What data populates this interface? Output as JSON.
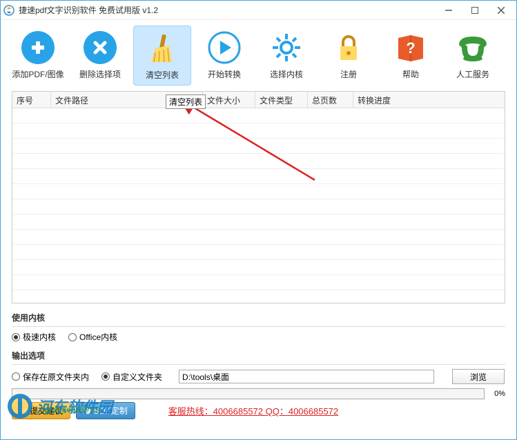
{
  "titlebar": {
    "title": "捷速pdf文字识别软件 免费试用版 v1.2"
  },
  "toolbar": {
    "items": [
      {
        "label": "添加PDF/图像"
      },
      {
        "label": "删除选择项"
      },
      {
        "label": "清空列表"
      },
      {
        "label": "开始转换"
      },
      {
        "label": "选择内核"
      },
      {
        "label": "注册"
      },
      {
        "label": "帮助"
      },
      {
        "label": "人工服务"
      }
    ]
  },
  "tooltip": "清空列表",
  "table": {
    "headers": [
      "序号",
      "文件路径",
      "文件大小",
      "文件类型",
      "总页数",
      "转换进度"
    ]
  },
  "kernel_section": {
    "title": "使用内核",
    "options": [
      "极速内核",
      "Office内核"
    ]
  },
  "output_section": {
    "title": "输出选项",
    "options": [
      "保存在原文件夹内",
      "自定义文件夹"
    ],
    "path": "D:\\tools\\桌面",
    "browse": "浏览"
  },
  "progress": {
    "percent": "0%"
  },
  "bottom": {
    "btn1": "提交建议",
    "btn2": "SDK定制",
    "hotline": "客服热线：4006685572 QQ：4006685572"
  },
  "watermark": {
    "text": "河东软件园",
    "url": "www.pc0359.cn"
  }
}
